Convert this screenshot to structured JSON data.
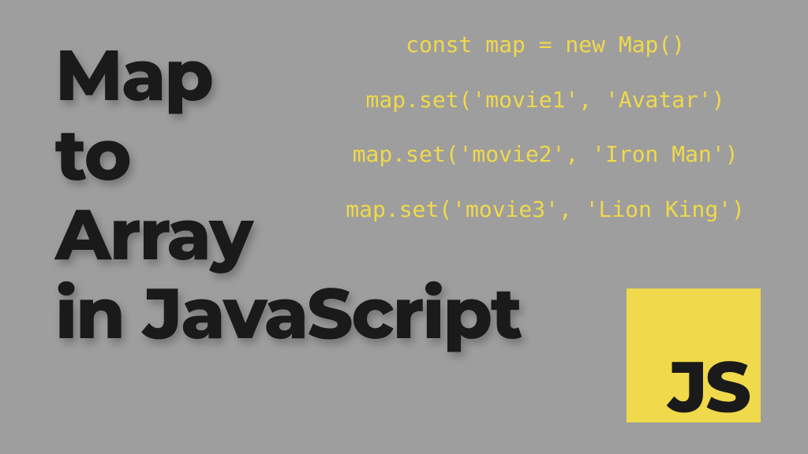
{
  "title": {
    "line1": "Map",
    "line2": "to",
    "line3": "Array",
    "line4": "in JavaScript"
  },
  "code": {
    "line1": "const map = new Map()",
    "line2": "map.set('movie1', 'Avatar')",
    "line3": "map.set('movie2', 'Iron Man')",
    "line4": "map.set('movie3', 'Lion King')"
  },
  "logo": {
    "text": "JS"
  }
}
